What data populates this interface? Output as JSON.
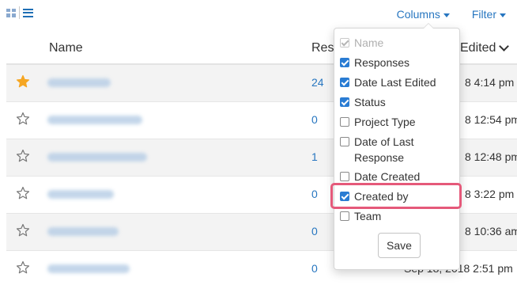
{
  "toolbar": {
    "columns_label": "Columns",
    "filter_label": "Filter"
  },
  "table": {
    "headers": {
      "name": "Name",
      "responses": "Resp",
      "edited": "Edited"
    },
    "rows": [
      {
        "starred": true,
        "responses": "24",
        "edited": "8 4:14 pm"
      },
      {
        "starred": false,
        "responses": "0",
        "edited": "8 12:54 pm"
      },
      {
        "starred": false,
        "responses": "1",
        "edited": "8 12:48 pm"
      },
      {
        "starred": false,
        "responses": "0",
        "edited": "8 3:22 pm"
      },
      {
        "starred": false,
        "responses": "0",
        "edited": "8 10:36 am"
      },
      {
        "starred": false,
        "responses": "0",
        "edited": "Sep 18, 2018 2:51 pm"
      }
    ]
  },
  "columns_menu": {
    "options": [
      {
        "label": "Name",
        "checked": true,
        "disabled": true
      },
      {
        "label": "Responses",
        "checked": true,
        "disabled": false
      },
      {
        "label": "Date Last Edited",
        "checked": true,
        "disabled": false
      },
      {
        "label": "Status",
        "checked": true,
        "disabled": false
      },
      {
        "label": "Project Type",
        "checked": false,
        "disabled": false
      },
      {
        "label": "Date of Last Response",
        "checked": false,
        "disabled": false
      },
      {
        "label": "Date Created",
        "checked": false,
        "disabled": false
      },
      {
        "label": "Created by",
        "checked": true,
        "disabled": false
      },
      {
        "label": "Team",
        "checked": false,
        "disabled": false
      }
    ],
    "save_label": "Save"
  },
  "colors": {
    "accent": "#2776c0",
    "star_active": "#f5a623",
    "highlight": "#e5597a"
  }
}
